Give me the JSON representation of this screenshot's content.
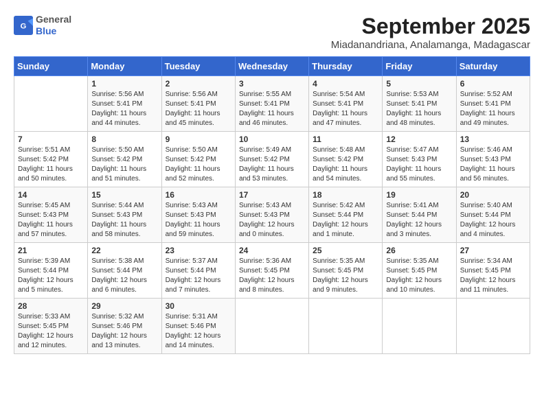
{
  "header": {
    "logo_general": "General",
    "logo_blue": "Blue",
    "month_title": "September 2025",
    "location": "Miadanandriana, Analamanga, Madagascar"
  },
  "days_of_week": [
    "Sunday",
    "Monday",
    "Tuesday",
    "Wednesday",
    "Thursday",
    "Friday",
    "Saturday"
  ],
  "weeks": [
    [
      {
        "day": "",
        "sunrise": "",
        "sunset": "",
        "daylight": ""
      },
      {
        "day": "1",
        "sunrise": "Sunrise: 5:56 AM",
        "sunset": "Sunset: 5:41 PM",
        "daylight": "Daylight: 11 hours and 44 minutes."
      },
      {
        "day": "2",
        "sunrise": "Sunrise: 5:56 AM",
        "sunset": "Sunset: 5:41 PM",
        "daylight": "Daylight: 11 hours and 45 minutes."
      },
      {
        "day": "3",
        "sunrise": "Sunrise: 5:55 AM",
        "sunset": "Sunset: 5:41 PM",
        "daylight": "Daylight: 11 hours and 46 minutes."
      },
      {
        "day": "4",
        "sunrise": "Sunrise: 5:54 AM",
        "sunset": "Sunset: 5:41 PM",
        "daylight": "Daylight: 11 hours and 47 minutes."
      },
      {
        "day": "5",
        "sunrise": "Sunrise: 5:53 AM",
        "sunset": "Sunset: 5:41 PM",
        "daylight": "Daylight: 11 hours and 48 minutes."
      },
      {
        "day": "6",
        "sunrise": "Sunrise: 5:52 AM",
        "sunset": "Sunset: 5:41 PM",
        "daylight": "Daylight: 11 hours and 49 minutes."
      }
    ],
    [
      {
        "day": "7",
        "sunrise": "Sunrise: 5:51 AM",
        "sunset": "Sunset: 5:42 PM",
        "daylight": "Daylight: 11 hours and 50 minutes."
      },
      {
        "day": "8",
        "sunrise": "Sunrise: 5:50 AM",
        "sunset": "Sunset: 5:42 PM",
        "daylight": "Daylight: 11 hours and 51 minutes."
      },
      {
        "day": "9",
        "sunrise": "Sunrise: 5:50 AM",
        "sunset": "Sunset: 5:42 PM",
        "daylight": "Daylight: 11 hours and 52 minutes."
      },
      {
        "day": "10",
        "sunrise": "Sunrise: 5:49 AM",
        "sunset": "Sunset: 5:42 PM",
        "daylight": "Daylight: 11 hours and 53 minutes."
      },
      {
        "day": "11",
        "sunrise": "Sunrise: 5:48 AM",
        "sunset": "Sunset: 5:42 PM",
        "daylight": "Daylight: 11 hours and 54 minutes."
      },
      {
        "day": "12",
        "sunrise": "Sunrise: 5:47 AM",
        "sunset": "Sunset: 5:43 PM",
        "daylight": "Daylight: 11 hours and 55 minutes."
      },
      {
        "day": "13",
        "sunrise": "Sunrise: 5:46 AM",
        "sunset": "Sunset: 5:43 PM",
        "daylight": "Daylight: 11 hours and 56 minutes."
      }
    ],
    [
      {
        "day": "14",
        "sunrise": "Sunrise: 5:45 AM",
        "sunset": "Sunset: 5:43 PM",
        "daylight": "Daylight: 11 hours and 57 minutes."
      },
      {
        "day": "15",
        "sunrise": "Sunrise: 5:44 AM",
        "sunset": "Sunset: 5:43 PM",
        "daylight": "Daylight: 11 hours and 58 minutes."
      },
      {
        "day": "16",
        "sunrise": "Sunrise: 5:43 AM",
        "sunset": "Sunset: 5:43 PM",
        "daylight": "Daylight: 11 hours and 59 minutes."
      },
      {
        "day": "17",
        "sunrise": "Sunrise: 5:43 AM",
        "sunset": "Sunset: 5:43 PM",
        "daylight": "Daylight: 12 hours and 0 minutes."
      },
      {
        "day": "18",
        "sunrise": "Sunrise: 5:42 AM",
        "sunset": "Sunset: 5:44 PM",
        "daylight": "Daylight: 12 hours and 1 minute."
      },
      {
        "day": "19",
        "sunrise": "Sunrise: 5:41 AM",
        "sunset": "Sunset: 5:44 PM",
        "daylight": "Daylight: 12 hours and 3 minutes."
      },
      {
        "day": "20",
        "sunrise": "Sunrise: 5:40 AM",
        "sunset": "Sunset: 5:44 PM",
        "daylight": "Daylight: 12 hours and 4 minutes."
      }
    ],
    [
      {
        "day": "21",
        "sunrise": "Sunrise: 5:39 AM",
        "sunset": "Sunset: 5:44 PM",
        "daylight": "Daylight: 12 hours and 5 minutes."
      },
      {
        "day": "22",
        "sunrise": "Sunrise: 5:38 AM",
        "sunset": "Sunset: 5:44 PM",
        "daylight": "Daylight: 12 hours and 6 minutes."
      },
      {
        "day": "23",
        "sunrise": "Sunrise: 5:37 AM",
        "sunset": "Sunset: 5:44 PM",
        "daylight": "Daylight: 12 hours and 7 minutes."
      },
      {
        "day": "24",
        "sunrise": "Sunrise: 5:36 AM",
        "sunset": "Sunset: 5:45 PM",
        "daylight": "Daylight: 12 hours and 8 minutes."
      },
      {
        "day": "25",
        "sunrise": "Sunrise: 5:35 AM",
        "sunset": "Sunset: 5:45 PM",
        "daylight": "Daylight: 12 hours and 9 minutes."
      },
      {
        "day": "26",
        "sunrise": "Sunrise: 5:35 AM",
        "sunset": "Sunset: 5:45 PM",
        "daylight": "Daylight: 12 hours and 10 minutes."
      },
      {
        "day": "27",
        "sunrise": "Sunrise: 5:34 AM",
        "sunset": "Sunset: 5:45 PM",
        "daylight": "Daylight: 12 hours and 11 minutes."
      }
    ],
    [
      {
        "day": "28",
        "sunrise": "Sunrise: 5:33 AM",
        "sunset": "Sunset: 5:45 PM",
        "daylight": "Daylight: 12 hours and 12 minutes."
      },
      {
        "day": "29",
        "sunrise": "Sunrise: 5:32 AM",
        "sunset": "Sunset: 5:46 PM",
        "daylight": "Daylight: 12 hours and 13 minutes."
      },
      {
        "day": "30",
        "sunrise": "Sunrise: 5:31 AM",
        "sunset": "Sunset: 5:46 PM",
        "daylight": "Daylight: 12 hours and 14 minutes."
      },
      {
        "day": "",
        "sunrise": "",
        "sunset": "",
        "daylight": ""
      },
      {
        "day": "",
        "sunrise": "",
        "sunset": "",
        "daylight": ""
      },
      {
        "day": "",
        "sunrise": "",
        "sunset": "",
        "daylight": ""
      },
      {
        "day": "",
        "sunrise": "",
        "sunset": "",
        "daylight": ""
      }
    ]
  ]
}
